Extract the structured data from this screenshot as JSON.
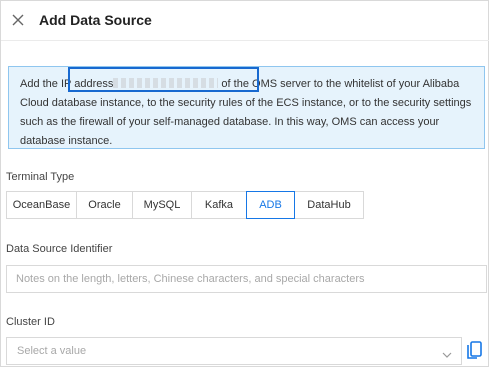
{
  "dialog": {
    "title": "Add Data Source",
    "close_icon": "close-icon"
  },
  "notice": {
    "text_before": "Add the IP address",
    "text_after": " of the OMS server to the whitelist of your Alibaba Cloud database instance, to the security rules of the ECS instance, or to the security settings such as the firewall of your self-managed database. In this way, OMS can access your database instance."
  },
  "terminal_type": {
    "label": "Terminal Type",
    "options": [
      "OceanBase",
      "Oracle",
      "MySQL",
      "Kafka",
      "ADB",
      "DataHub"
    ],
    "selected": "ADB"
  },
  "data_source_identifier": {
    "label": "Data Source Identifier",
    "value": "",
    "placeholder": "Notes on the length, letters, Chinese characters, and special characters"
  },
  "cluster_id": {
    "label": "Cluster ID",
    "placeholder": "Select a value",
    "dropdown_icon": "chevron-down-icon",
    "copy_icon": "copy-icon"
  },
  "colors": {
    "accent": "#1677e6",
    "notice_background": "#e6f3fc",
    "notice_border": "#8fc6ef",
    "highlight_border": "#1769d0"
  }
}
